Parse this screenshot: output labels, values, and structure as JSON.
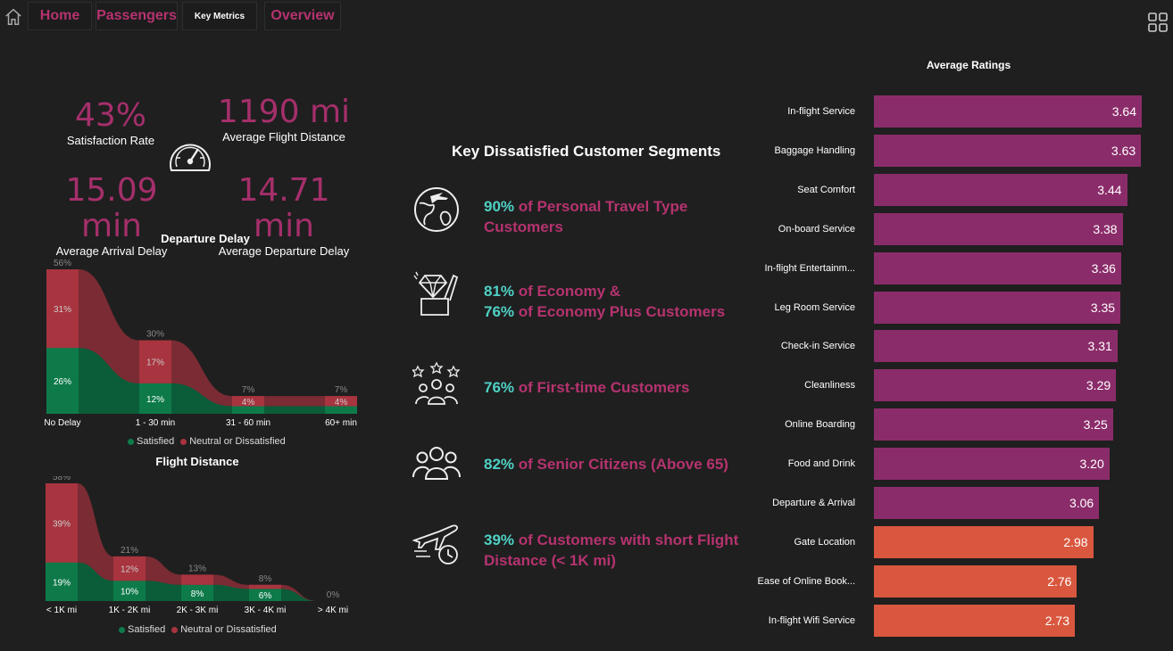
{
  "nav": {
    "tabs": [
      {
        "label": "Home"
      },
      {
        "label": "Passengers"
      },
      {
        "label": "Key Metrics"
      },
      {
        "label": "Overview"
      }
    ]
  },
  "kpis": {
    "satisfaction": {
      "value": "43%",
      "label": "Satisfaction Rate"
    },
    "distance": {
      "value": "1190 mi",
      "label": "Average Flight Distance"
    },
    "arrival": {
      "value": "15.09 min",
      "label": "Average Arrival Delay"
    },
    "departure": {
      "value": "14.71 min",
      "label": "Average Departure Delay"
    }
  },
  "colors": {
    "satisfied": "#0e7a4a",
    "dissatisfied": "#a8343f",
    "accent": "#b5336f",
    "highlight": "#4fd1c5",
    "bar_high": "#8b2c6a",
    "bar_low": "#d9573e"
  },
  "legend": {
    "satisfied": "Satisfied",
    "dissatisfied": "Neutral or Dissatisfied"
  },
  "chart_data": [
    {
      "type": "area",
      "title": "Departure Delay",
      "categories": [
        "No Delay",
        "1 - 30 min",
        "31 - 60 min",
        "60+ min"
      ],
      "totals": [
        "56%",
        "30%",
        "7%",
        "7%"
      ],
      "series": [
        {
          "name": "Satisfied",
          "values": [
            26,
            12,
            3,
            3
          ],
          "labels": [
            "26%",
            "12%",
            "",
            ""
          ]
        },
        {
          "name": "Neutral or Dissatisfied",
          "values": [
            31,
            17,
            4,
            4
          ],
          "labels": [
            "31%",
            "17%",
            "4%",
            "4%"
          ]
        }
      ],
      "ylim": [
        0,
        57
      ]
    },
    {
      "type": "area",
      "title": "Flight Distance",
      "categories": [
        "< 1K mi",
        "1K - 2K mi",
        "2K - 3K mi",
        "3K - 4K mi",
        "> 4K mi"
      ],
      "totals": [
        "58%",
        "21%",
        "13%",
        "8%",
        "0%"
      ],
      "series": [
        {
          "name": "Satisfied",
          "values": [
            19,
            10,
            8,
            6,
            0
          ],
          "labels": [
            "19%",
            "10%",
            "8%",
            "6%",
            ""
          ]
        },
        {
          "name": "Neutral or Dissatisfied",
          "values": [
            39,
            12,
            5,
            2,
            0
          ],
          "labels": [
            "39%",
            "12%",
            "",
            "",
            ""
          ]
        }
      ],
      "ylim": [
        0,
        58
      ]
    },
    {
      "type": "bar",
      "title": "Average Ratings",
      "categories": [
        "In-flight Service",
        "Baggage Handling",
        "Seat Comfort",
        "On-board Service",
        "In-flight Entertainm...",
        "Leg Room Service",
        "Check-in Service",
        "Cleanliness",
        "Online Boarding",
        "Food and Drink",
        "Departure & Arrival",
        "Gate Location",
        "Ease of Online Book...",
        "In-flight Wifi Service"
      ],
      "values": [
        3.64,
        3.63,
        3.44,
        3.38,
        3.36,
        3.35,
        3.31,
        3.29,
        3.25,
        3.2,
        3.06,
        2.98,
        2.76,
        2.73
      ],
      "value_labels": [
        "3.64",
        "3.63",
        "3.44",
        "3.38",
        "3.36",
        "3.35",
        "3.31",
        "3.29",
        "3.25",
        "3.20",
        "3.06",
        "2.98",
        "2.76",
        "2.73"
      ],
      "xlim": [
        0,
        3.64
      ]
    }
  ],
  "segments": {
    "title": "Key Dissatisfied Customer Segments",
    "items": [
      {
        "icon": "globe-plane-icon",
        "pct": "90%",
        "text": " of Personal Travel Type Customers"
      },
      {
        "icon": "diamond-basket-icon",
        "pct": "81%",
        "text": " of Economy &",
        "pct2": "76%",
        "text2": " of Economy Plus Customers"
      },
      {
        "icon": "stars-people-icon",
        "pct": "76%",
        "text": " of First-time Customers"
      },
      {
        "icon": "senior-group-icon",
        "pct": "82%",
        "text": " of Senior Citizens (Above 65)"
      },
      {
        "icon": "plane-clock-icon",
        "pct": "39%",
        "text": " of Customers with short Flight Distance (< 1K mi)"
      }
    ]
  }
}
